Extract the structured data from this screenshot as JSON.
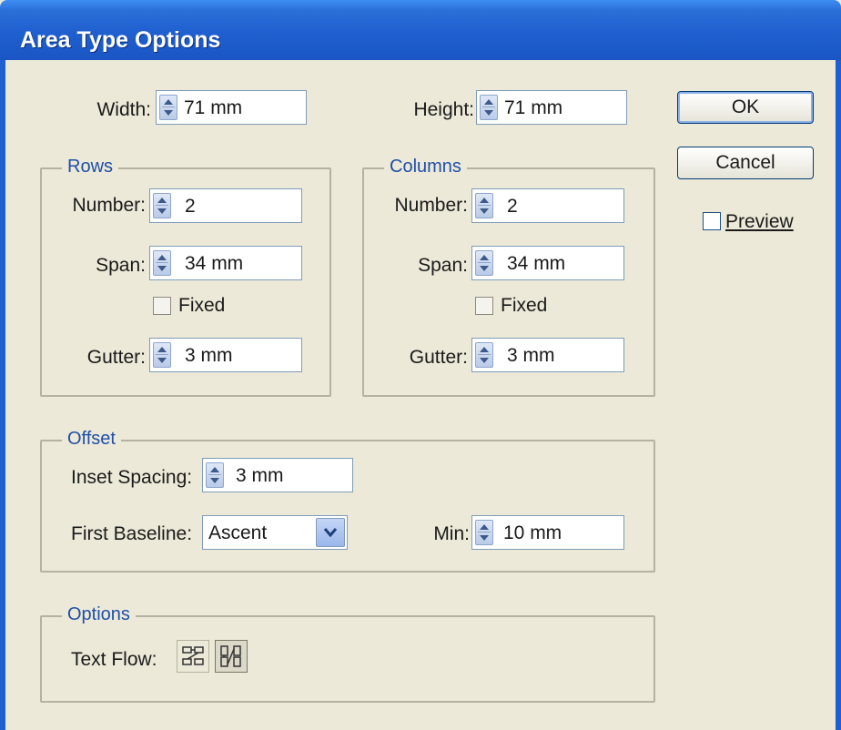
{
  "window": {
    "title": "Area Type Options"
  },
  "size": {
    "width_label": "Width:",
    "width_value": "71 mm",
    "height_label": "Height:",
    "height_value": "71 mm"
  },
  "rows": {
    "legend": "Rows",
    "number_label": "Number:",
    "number_value": "2",
    "span_label": "Span:",
    "span_value": "34 mm",
    "fixed_label": "Fixed",
    "gutter_label": "Gutter:",
    "gutter_value": "3 mm"
  },
  "columns": {
    "legend": "Columns",
    "number_label": "Number:",
    "number_value": "2",
    "span_label": "Span:",
    "span_value": "34 mm",
    "fixed_label": "Fixed",
    "gutter_label": "Gutter:",
    "gutter_value": "3 mm"
  },
  "offset": {
    "legend": "Offset",
    "inset_label": "Inset Spacing:",
    "inset_value": "3 mm",
    "baseline_label": "First Baseline:",
    "baseline_value": "Ascent",
    "min_label": "Min:",
    "min_value": "10 mm"
  },
  "options": {
    "legend": "Options",
    "textflow_label": "Text Flow:",
    "textflow_icons": [
      "text-flow-by-rows-icon",
      "text-flow-by-columns-icon"
    ]
  },
  "buttons": {
    "ok": "OK",
    "cancel": "Cancel",
    "preview": "Preview"
  },
  "colors": {
    "titlebar": "#1f5fcf",
    "legend": "#1f4fa8",
    "dialog": "#ece9d8"
  }
}
